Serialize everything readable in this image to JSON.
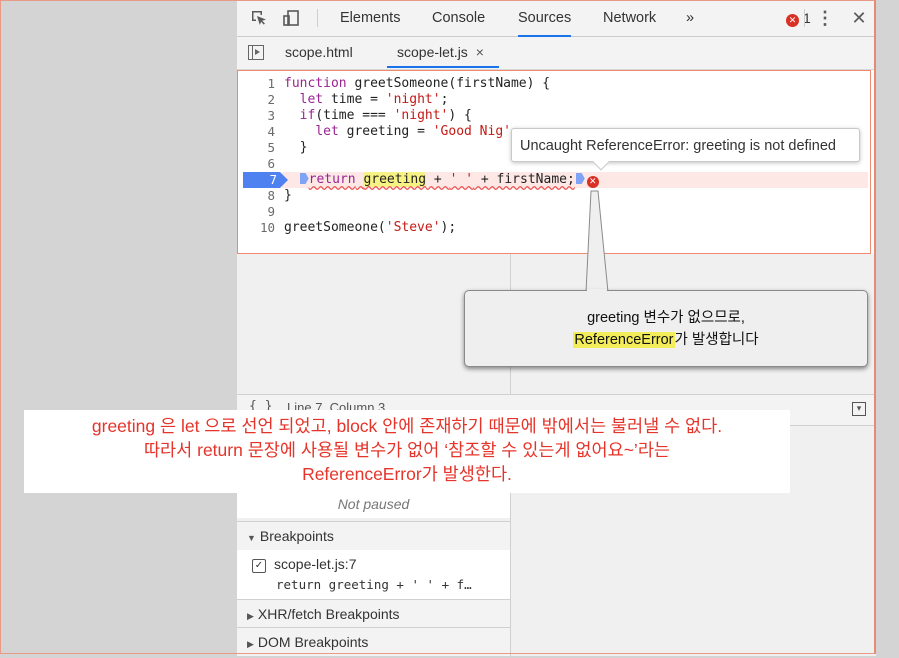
{
  "toolbar": {
    "tabs": [
      "Elements",
      "Console",
      "Sources",
      "Network"
    ],
    "more": "»",
    "error_count": "1",
    "icons": [
      "inspect-icon",
      "device-icon",
      "more-vert-icon",
      "close-icon"
    ]
  },
  "file_tabs": {
    "toggle_icon": "navigator-toggle-icon",
    "files": [
      "scope.html",
      "scope-let.js"
    ],
    "close": "×"
  },
  "editor": {
    "line_numbers": [
      "1",
      "2",
      "3",
      "4",
      "5",
      "6",
      "7",
      "8",
      "9",
      "10"
    ],
    "error_tooltip": "Uncaught ReferenceError: greeting is not defined"
  },
  "callout": {
    "line1": "greeting 변수가 없으므로,",
    "line2_highlight": "ReferenceError",
    "line2_rest": "가 발생합니다"
  },
  "status": {
    "icon": "{ }",
    "text": "Line 7, Column 3"
  },
  "debugger": {
    "not_paused": "Not paused",
    "breakpoints_header": "Breakpoints",
    "breakpoint_file": "scope-let.js:7",
    "breakpoint_code": "return greeting + ' ' + f…",
    "xhr_header": "XHR/fetch Breakpoints",
    "dom_header": "DOM Breakpoints"
  },
  "annotation": {
    "line1": "greeting 은 let 으로 선언 되었고, block 안에 존재하기 때문에 밖에서는 불러낼 수 없다.",
    "line2": "따라서 return 문장에 사용될 변수가 없어 ‘참조할 수 있는게 없어요~’라는",
    "line3": "ReferenceError가 발생한다."
  },
  "colors": {
    "accent": "#1a73e8",
    "breakpoint": "#4f82f0",
    "error": "#d93025",
    "annotation": "#e6342a",
    "highlight": "#f3ed5a"
  }
}
